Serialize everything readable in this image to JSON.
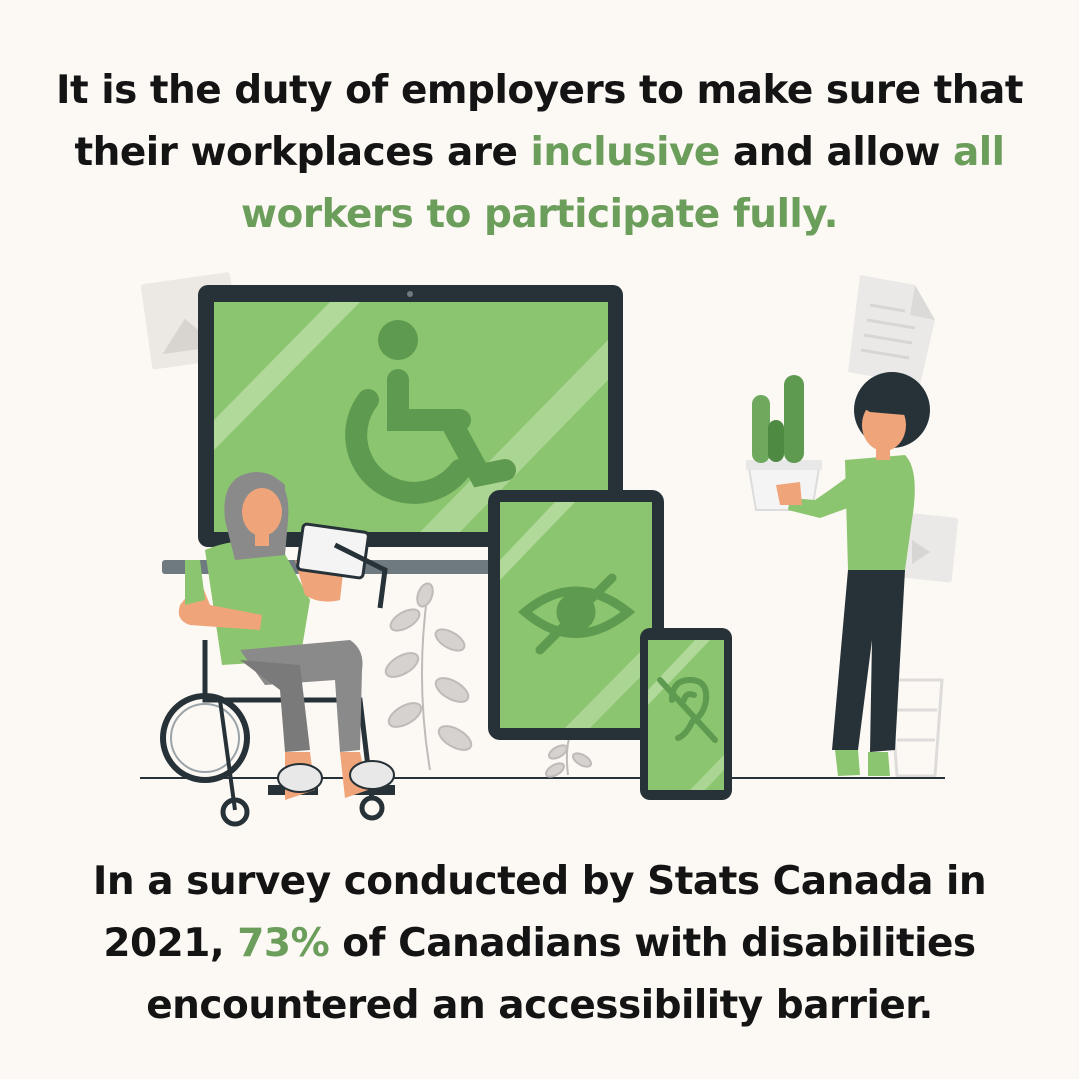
{
  "top_text": {
    "part1": "It is the duty of employers to make sure that their workplaces are ",
    "highlight1": "inclusive",
    "part2": " and allow ",
    "highlight2": "all workers to participate fully."
  },
  "bottom_text": {
    "part1": "In a survey conducted by Stats Canada in 2021, ",
    "highlight": "73%",
    "part2": " of Canadians with disabilities encountered an accessibility barrier."
  },
  "colors": {
    "background": "#fcf8f4",
    "accent_green": "#6b9e5b",
    "screen_green": "#8cc56f",
    "device_dark": "#263238",
    "text": "#141414"
  },
  "illustration": {
    "icons": [
      "wheelchair-icon",
      "eye-slash-icon",
      "ear-slash-icon"
    ]
  }
}
